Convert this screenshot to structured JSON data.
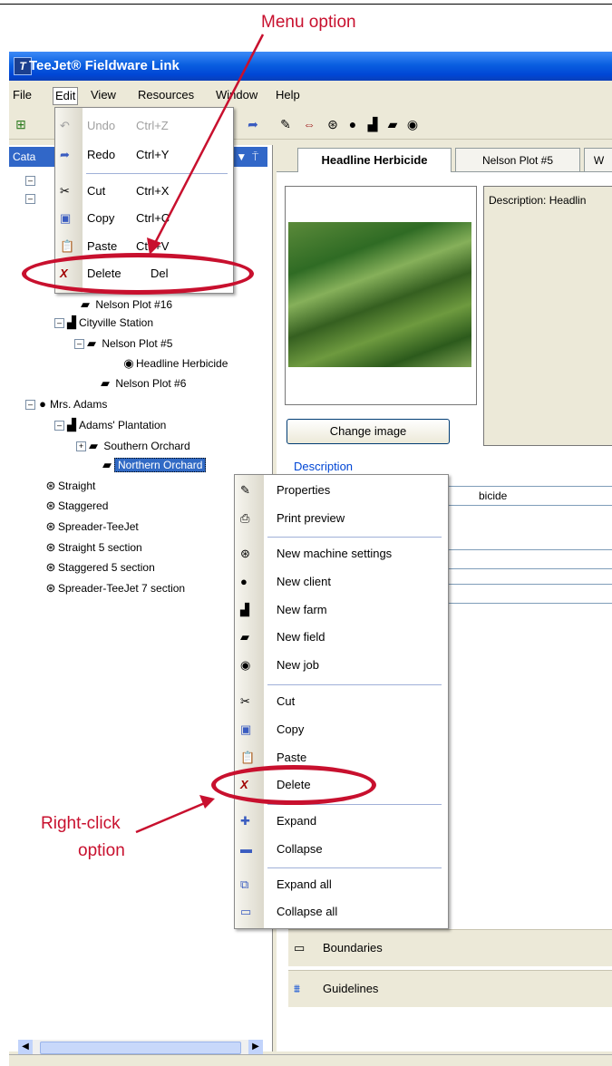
{
  "annotations": {
    "menu_option": "Menu option",
    "right_click_line1": "Right-click",
    "right_click_line2": "option"
  },
  "window": {
    "title": "TeeJet® Fieldware Link"
  },
  "menubar": [
    "File",
    "Edit",
    "View",
    "Resources",
    "Window",
    "Help"
  ],
  "panel": {
    "title": "Cata",
    "pin": " ▼  ⍑"
  },
  "tree": {
    "nelson16": "Nelson Plot #16",
    "cityville": "Cityville Station",
    "nelson5": "Nelson Plot #5",
    "headline": "Headline Herbicide",
    "nelson6": "Nelson Plot #6",
    "adams": "Mrs. Adams",
    "plantation": "Adams' Plantation",
    "southern": "Southern Orchard",
    "northern": "Northern Orchard",
    "straight": "Straight",
    "staggered": "Staggered",
    "spreader": "Spreader-TeeJet",
    "straight5": "Straight 5 section",
    "staggered5": "Staggered 5 section",
    "spreader7": "Spreader-TeeJet 7 section"
  },
  "tabs": [
    "Headline Herbicide",
    "Nelson Plot #5",
    "W"
  ],
  "details": {
    "description_preview": "Description: Headlin",
    "change_image": "Change image",
    "description_group": "Description",
    "field_value": "bicide",
    "boundaries": "Boundaries",
    "guidelines": "Guidelines"
  },
  "edit_menu": [
    {
      "label": "Undo",
      "shortcut": "Ctrl+Z"
    },
    {
      "label": "Redo",
      "shortcut": "Ctrl+Y"
    },
    {
      "label": "Cut",
      "shortcut": "Ctrl+X"
    },
    {
      "label": "Copy",
      "shortcut": "Ctrl+C"
    },
    {
      "label": "Paste",
      "shortcut": "Ctrl+V"
    },
    {
      "label": "Delete",
      "shortcut": "Del"
    }
  ],
  "context_menu": [
    "Properties",
    "Print preview",
    "New machine settings",
    "New client",
    "New farm",
    "New field",
    "New job",
    "Cut",
    "Copy",
    "Paste",
    "Delete",
    "Expand",
    "Collapse",
    "Expand all",
    "Collapse all"
  ],
  "colors": {
    "callout": "#c8102e",
    "selection": "#316ac5",
    "titlebar": "#0a5fe0"
  }
}
